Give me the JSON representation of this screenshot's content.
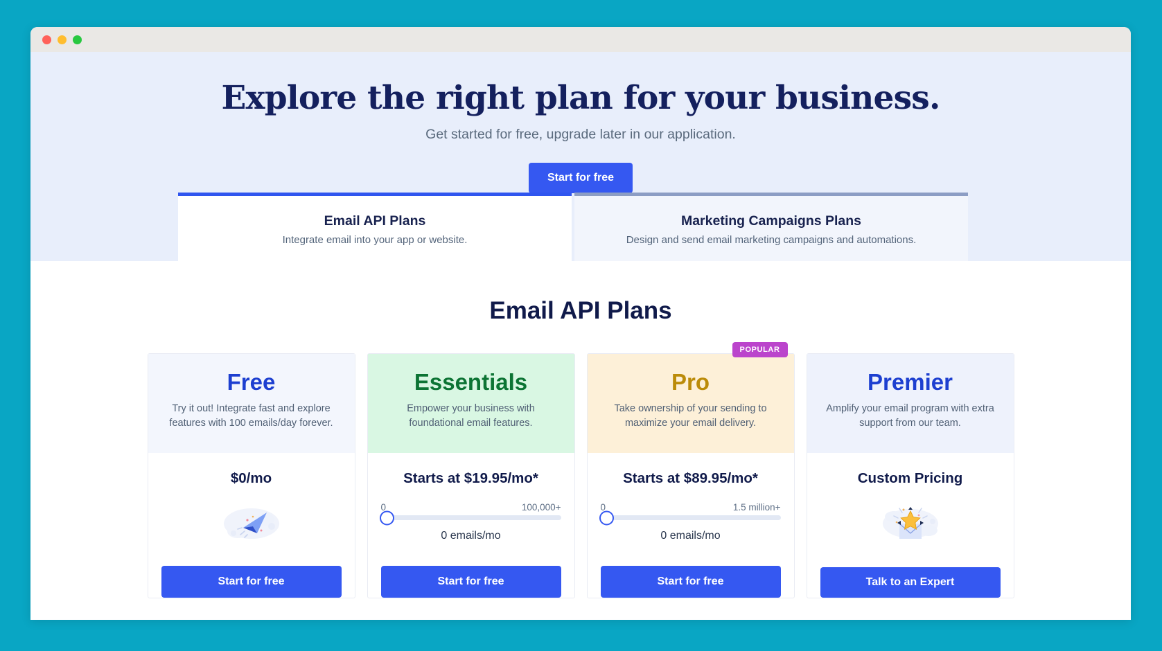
{
  "window": {
    "traffic_lights": [
      "close",
      "minimize",
      "maximize"
    ]
  },
  "hero": {
    "title": "Explore the right plan for your business.",
    "subtitle": "Get started for free, upgrade later in our application.",
    "cta_label": "Start for free"
  },
  "tabs": [
    {
      "title": "Email API Plans",
      "desc": "Integrate email into your app or website.",
      "active": true
    },
    {
      "title": "Marketing Campaigns Plans",
      "desc": "Design and send email marketing campaigns and automations.",
      "active": false
    }
  ],
  "plans_section": {
    "heading": "Email API Plans"
  },
  "cards": [
    {
      "name": "Free",
      "desc": "Try it out! Integrate fast and explore features with 100 emails/day forever.",
      "price": "$0/mo",
      "has_slider": false,
      "illustration": "paper-plane-icon",
      "cta_label": "Start for free",
      "badge": null
    },
    {
      "name": "Essentials",
      "desc": "Empower your business with foundational email features.",
      "price": "Starts at $19.95/mo*",
      "has_slider": true,
      "slider_min_label": "0",
      "slider_max_label": "100,000+",
      "slider_value_label": "0 emails/mo",
      "illustration": null,
      "cta_label": "Start for free",
      "badge": null
    },
    {
      "name": "Pro",
      "desc": "Take ownership of your sending to maximize your email delivery.",
      "price": "Starts at $89.95/mo*",
      "has_slider": true,
      "slider_min_label": "0",
      "slider_max_label": "1.5 million+",
      "slider_value_label": "0 emails/mo",
      "illustration": null,
      "cta_label": "Start for free",
      "badge": "POPULAR"
    },
    {
      "name": "Premier",
      "desc": "Amplify your email program with extra support from our team.",
      "price": "Custom Pricing",
      "has_slider": false,
      "illustration": "envelope-star-icon",
      "cta_label": "Talk to an Expert",
      "badge": null
    }
  ],
  "colors": {
    "page_background": "#09a6c4",
    "accent_blue": "#3558f1",
    "hero_background": "#e8eefb",
    "heading_navy": "#101a4a",
    "badge_purple": "#bb44cc",
    "essentials_green": "#0c7434",
    "pro_gold": "#bb8b09"
  }
}
